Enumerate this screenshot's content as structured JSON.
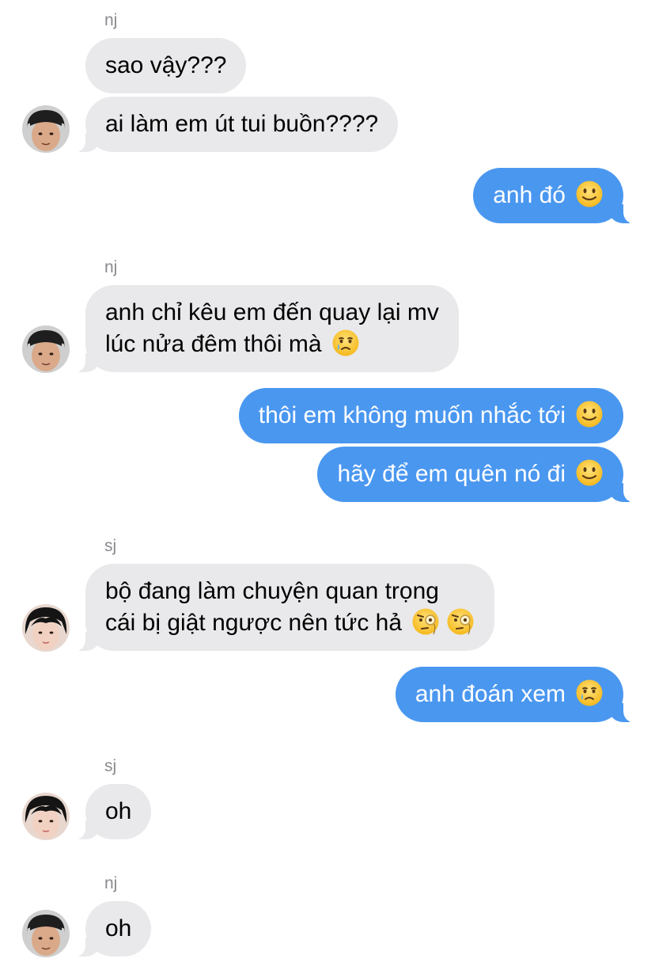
{
  "conversation": [
    {
      "type": "label",
      "text": "nj"
    },
    {
      "type": "in",
      "lines": [
        "sao vậy???"
      ],
      "emojis": []
    },
    {
      "type": "in",
      "lines": [
        "ai làm em út tui buồn????"
      ],
      "emojis": [],
      "avatar": "nj-avatar"
    },
    {
      "type": "out",
      "lines": [
        "anh đó"
      ],
      "emojis": [
        "slightly-smiling-face"
      ]
    },
    {
      "type": "label",
      "text": "nj"
    },
    {
      "type": "in",
      "lines": [
        "anh chỉ kêu em đến quay lại mv",
        "lúc nửa đêm thôi mà"
      ],
      "emojis": [
        "face-holding-back-tears"
      ],
      "avatar": "nj-avatar"
    },
    {
      "type": "out",
      "lines": [
        "thôi em không muốn nhắc tới"
      ],
      "emojis": [
        "slightly-smiling-face"
      ]
    },
    {
      "type": "out",
      "lines": [
        "hãy để em quên nó đi"
      ],
      "emojis": [
        "slightly-smiling-face"
      ]
    },
    {
      "type": "label",
      "text": "sj"
    },
    {
      "type": "in",
      "lines": [
        "bộ đang làm chuyện quan trọng",
        "cái bị giật ngược nên tức hả"
      ],
      "emojis": [
        "face-with-monocle",
        "face-with-monocle"
      ],
      "avatar": "sj-avatar"
    },
    {
      "type": "out",
      "lines": [
        "anh đoán xem"
      ],
      "emojis": [
        "face-holding-back-tears"
      ]
    },
    {
      "type": "label",
      "text": "sj"
    },
    {
      "type": "in",
      "lines": [
        "oh"
      ],
      "emojis": [],
      "avatar": "sj-avatar"
    },
    {
      "type": "label",
      "text": "nj"
    },
    {
      "type": "in",
      "lines": [
        "oh"
      ],
      "emojis": [],
      "avatar": "nj-avatar"
    }
  ],
  "colors": {
    "incoming_bubble": "#e9e9eb",
    "outgoing_bubble": "#4a97f0",
    "sender_label": "#8a8a8e"
  }
}
